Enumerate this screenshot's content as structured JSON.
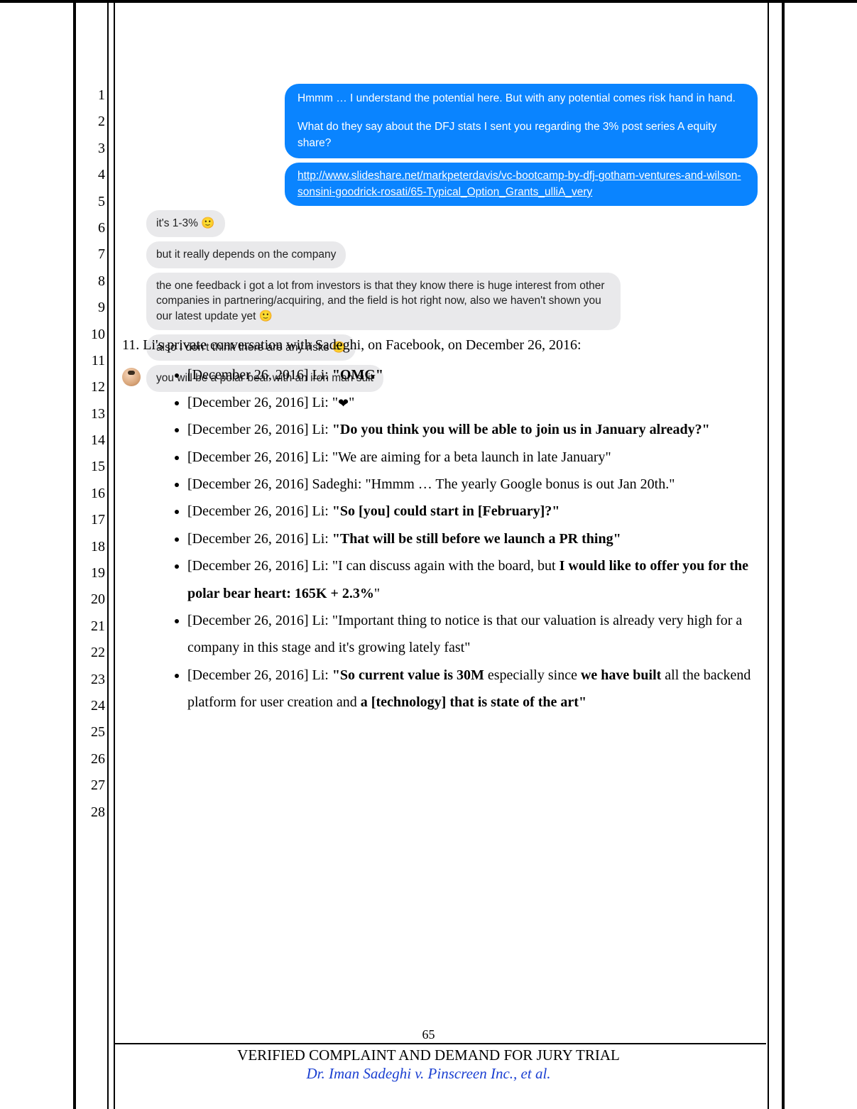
{
  "line_numbers": [
    "1",
    "2",
    "3",
    "4",
    "5",
    "6",
    "7",
    "8",
    "9",
    "10",
    "11",
    "12",
    "13",
    "14",
    "15",
    "16",
    "17",
    "18",
    "19",
    "20",
    "21",
    "22",
    "23",
    "24",
    "25",
    "26",
    "27",
    "28"
  ],
  "chat": {
    "blue1": "Hmmm … I understand the potential here. But with any potential comes risk hand in hand.",
    "blue2": "What do they say about the DFJ stats I sent you regarding the 3% post series A equity share?",
    "blue_link": "http://www.slideshare.net/markpeterdavis/vc-bootcamp-by-dfj-gotham-ventures-and-wilson-sonsini-goodrick-rosati/65-Typical_Option_Grants_ulliA_very",
    "grey1_pre": "it's 1-3% ",
    "grey1_emoji": "🙂",
    "grey2": "but it really depends on the company",
    "grey3_pre": "the one feedback i got a lot from investors is that they know there is huge interest from other companies in partnering/acquiring, and the field is hot right now, also we haven't shown you our latest update yet ",
    "grey3_emoji": "🙂",
    "grey4_pre": "also I don't think there are any risks ",
    "grey4_emoji": "🙂",
    "grey5": "you will be a polar bear with an iron man suit"
  },
  "para": {
    "lead": "11. Li's private conversation with Sadeghi, on Facebook, on December 26, 2016:",
    "b1_pre": "[December 26, 2016] Li: ",
    "b1_bold": "\"OMG\"",
    "b2_pre": "[December 26, 2016] Li: \"",
    "b2_heart": "❤",
    "b2_post": "\"",
    "b3_pre": "[December 26, 2016] Li: ",
    "b3_bold": "\"Do you think you will be able to join us in January already?\"",
    "b4": "[December 26, 2016] Li: \"We are aiming for a beta launch in late January\"",
    "b5": "[December 26, 2016] Sadeghi: \"Hmmm … The yearly Google bonus is out Jan 20th.\"",
    "b6_pre": "[December 26, 2016] Li: ",
    "b6_bold": "\"So [you] could start in [February]?\"",
    "b7_pre": "[December 26, 2016] Li: ",
    "b7_bold": "\"That will be still before we launch a PR thing\"",
    "b8_pre": "[December 26, 2016] Li: \"I can discuss again with the board, but ",
    "b8_bold": "I would like to offer you for the polar bear heart: 165K + 2.3%",
    "b8_post": "\"",
    "b9": "[December 26, 2016] Li: \"Important thing to notice is that our valuation is already very high for a company in this stage and it's growing lately fast\"",
    "b10_pre": "[December 26, 2016] Li: ",
    "b10_b1": "\"So current value is 30M ",
    "b10_mid": "especially since ",
    "b10_b2": "we have built ",
    "b10_plain": "all the backend platform for user creation and ",
    "b10_b3": "a [technology] that is state of the art\""
  },
  "footer": {
    "page_num": "65",
    "line1": "VERIFIED COMPLAINT AND DEMAND FOR JURY TRIAL",
    "line2": "Dr. Iman Sadeghi v. Pinscreen Inc., et al."
  }
}
